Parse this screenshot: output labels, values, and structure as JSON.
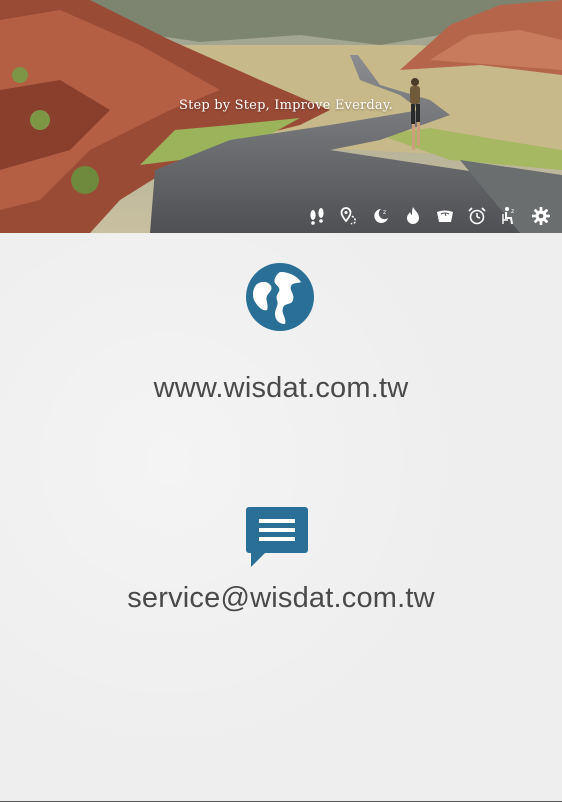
{
  "hero": {
    "tagline": "Step by Step, Improve Everday."
  },
  "toolbar": {
    "items": [
      {
        "icon": "footprints-icon"
      },
      {
        "icon": "map-pin-icon"
      },
      {
        "icon": "sleep-moon-icon"
      },
      {
        "icon": "flame-icon"
      },
      {
        "icon": "scale-icon"
      },
      {
        "icon": "alarm-clock-icon"
      },
      {
        "icon": "sitting-person-icon"
      },
      {
        "icon": "gear-icon"
      }
    ]
  },
  "contact": {
    "website": "www.wisdat.com.tw",
    "email": "service@wisdat.com.tw"
  },
  "colors": {
    "accent": "#2a6f96",
    "text": "#4a4a4a",
    "background": "#eeeeee"
  }
}
